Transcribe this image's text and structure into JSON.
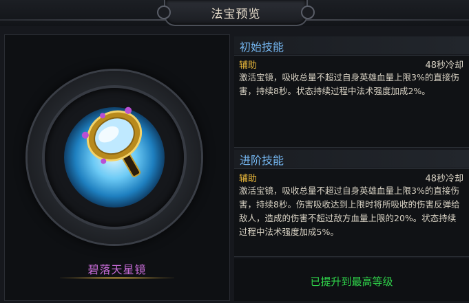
{
  "window": {
    "title": "法宝预览"
  },
  "item": {
    "name": "碧落天星镜"
  },
  "initial_skill": {
    "header": "初始技能",
    "type": "辅助",
    "cooldown": "48秒冷却",
    "description": "激活宝镜，吸收总量不超过自身英雄血量上限3%的直接伤害，持续8秒。状态持续过程中法术强度加成2%。"
  },
  "advanced_skill": {
    "header": "进阶技能",
    "type": "辅助",
    "cooldown": "48秒冷却",
    "description": "激活宝镜，吸收总量不超过自身英雄血量上限3%的直接伤害，持续8秒。伤害吸收达到上限时将所吸收的伤害反弹给敌人，造成的伤害不超过敌方血量上限的20%。状态持续过程中法术强度加成5%。"
  },
  "status": {
    "max_level_text": "已提升到最高等级"
  },
  "colors": {
    "header_blue": "#74b6f0",
    "type_gold": "#e8b73a",
    "item_name_purple": "#c66bd6",
    "max_level_green": "#2fd34a"
  }
}
